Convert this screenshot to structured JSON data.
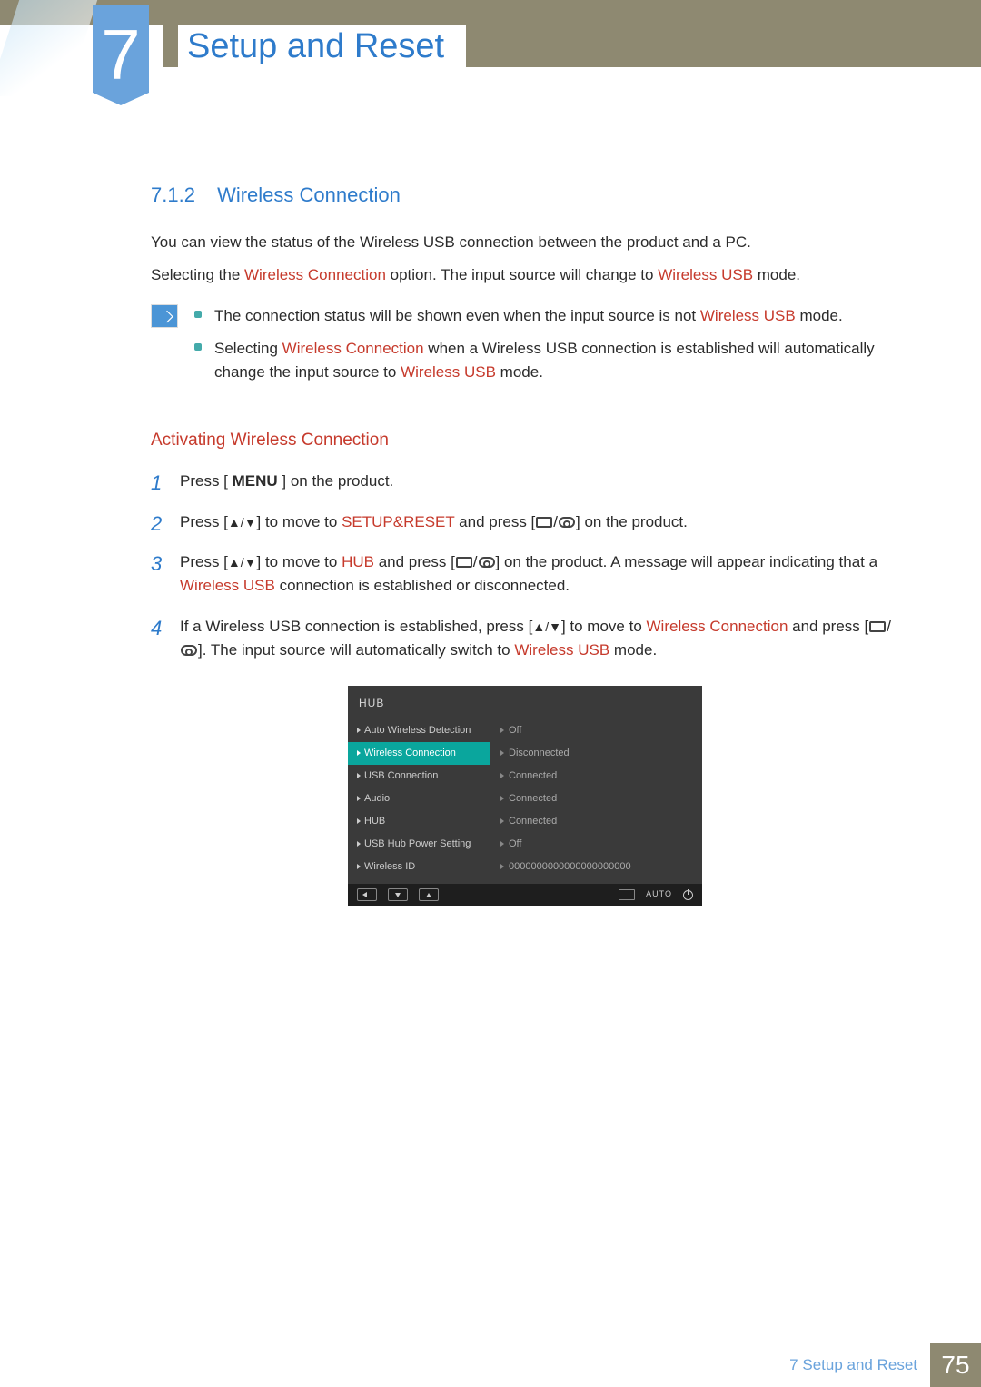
{
  "chapter": {
    "number": "7",
    "title": "Setup and Reset"
  },
  "section": {
    "number": "7.1.2",
    "title": "Wireless Connection",
    "intro1": {
      "t": "You can view the status of the Wireless USB connection between the product and a PC."
    },
    "intro2": {
      "a": "Selecting the ",
      "b": "Wireless Connection",
      "c": " option. The input source will change to ",
      "d": "Wireless USB",
      "e": " mode."
    },
    "notes": [
      {
        "a": "The connection status will be shown even when the input source is not ",
        "b": "Wireless USB",
        "c": " mode."
      },
      {
        "a": "Selecting ",
        "b": "Wireless Connection",
        "c": " when a Wireless USB connection is established will automatically change the input source to ",
        "d": "Wireless USB",
        "e": " mode."
      }
    ],
    "subhead": "Activating Wireless Connection",
    "steps": [
      {
        "n": "1",
        "a": "Press [ ",
        "menu": "MENU",
        "b": " ] on the product."
      },
      {
        "n": "2",
        "a": "Press [",
        "ud": "▲/▼",
        "b": "] to move to ",
        "c": "SETUP&RESET",
        "d": " and press [",
        "e": "] on the product."
      },
      {
        "n": "3",
        "a": "Press [",
        "ud": "▲/▼",
        "b": "] to move to ",
        "c": "HUB",
        "d": " and press [",
        "e": "] on the product. A message will appear indicating that a ",
        "f": "Wireless USB",
        "g": " connection is established or disconnected."
      },
      {
        "n": "4",
        "a": "If a Wireless USB connection is established, press [",
        "ud": "▲/▼",
        "b": "] to move to ",
        "c": "Wireless Connection",
        "d": " and press [",
        "e": "]. The input source will automatically switch to ",
        "f": "Wireless USB",
        "g": " mode."
      }
    ]
  },
  "osd": {
    "title": "HUB",
    "rows": [
      {
        "label": "Auto Wireless Detection",
        "value": "Off",
        "sel": false
      },
      {
        "label": "Wireless Connection",
        "value": "Disconnected",
        "sel": true
      },
      {
        "label": "USB Connection",
        "value": "Connected",
        "sel": false
      },
      {
        "label": "Audio",
        "value": "Connected",
        "sel": false
      },
      {
        "label": "HUB",
        "value": "Connected",
        "sel": false
      },
      {
        "label": "USB Hub Power Setting",
        "value": "Off",
        "sel": false
      },
      {
        "label": "Wireless ID",
        "value": "0000000000000000000000",
        "sel": false
      }
    ]
  },
  "footer": {
    "crumb": "7 Setup and Reset",
    "page": "75"
  }
}
